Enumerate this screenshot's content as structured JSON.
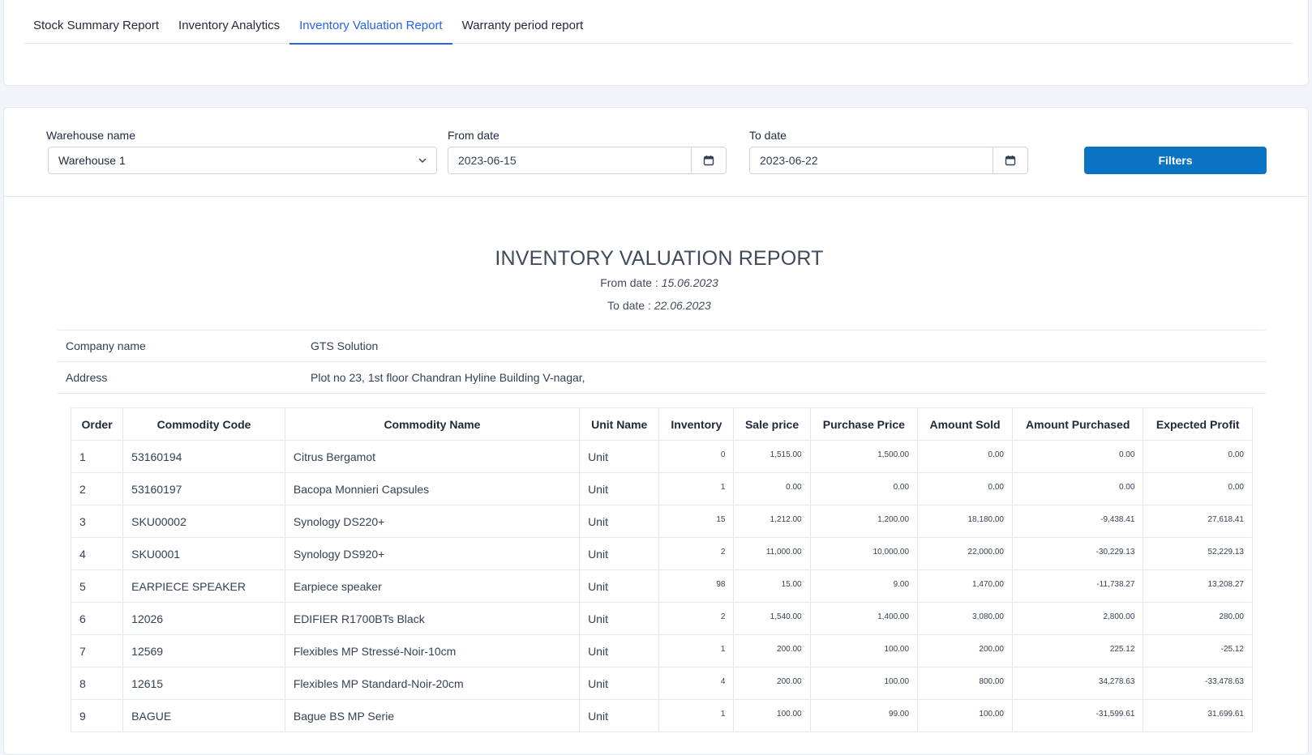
{
  "tabs": [
    {
      "label": "Stock Summary Report",
      "active": false
    },
    {
      "label": "Inventory Analytics",
      "active": false
    },
    {
      "label": "Inventory Valuation Report",
      "active": true
    },
    {
      "label": "Warranty period report",
      "active": false
    }
  ],
  "filters": {
    "warehouse_label": "Warehouse name",
    "warehouse_value": "Warehouse 1",
    "from_label": "From date",
    "from_value": "2023-06-15",
    "to_label": "To date",
    "to_value": "2023-06-22",
    "button_label": "Filters"
  },
  "report": {
    "title": "INVENTORY VALUATION REPORT",
    "from_prefix": "From date :",
    "from_date": "15.06.2023",
    "to_prefix": "To date :",
    "to_date": "22.06.2023",
    "company_key": "Company name",
    "company_value": "GTS Solution",
    "address_key": "Address",
    "address_value": "Plot no 23, 1st floor Chandran Hyline Building V-nagar,"
  },
  "table": {
    "headers": [
      "Order",
      "Commodity Code",
      "Commodity Name",
      "Unit Name",
      "Inventory",
      "Sale price",
      "Purchase Price",
      "Amount Sold",
      "Amount Purchased",
      "Expected Profit"
    ],
    "rows": [
      [
        "1",
        "53160194",
        "Citrus Bergamot",
        "Unit",
        "0",
        "1,515.00",
        "1,500.00",
        "0.00",
        "0.00",
        "0.00"
      ],
      [
        "2",
        "53160197",
        "Bacopa Monnieri Capsules",
        "Unit",
        "1",
        "0.00",
        "0.00",
        "0.00",
        "0.00",
        "0.00"
      ],
      [
        "3",
        "SKU00002",
        "Synology DS220+",
        "Unit",
        "15",
        "1,212.00",
        "1,200.00",
        "18,180.00",
        "-9,438.41",
        "27,618.41"
      ],
      [
        "4",
        "SKU0001",
        "Synology DS920+",
        "Unit",
        "2",
        "11,000.00",
        "10,000.00",
        "22,000.00",
        "-30,229.13",
        "52,229.13"
      ],
      [
        "5",
        "EARPIECE SPEAKER",
        "Earpiece speaker",
        "Unit",
        "98",
        "15.00",
        "9.00",
        "1,470.00",
        "-11,738.27",
        "13,208.27"
      ],
      [
        "6",
        "12026",
        "EDIFIER R1700BTs Black",
        "Unit",
        "2",
        "1,540.00",
        "1,400.00",
        "3,080.00",
        "2,800.00",
        "280.00"
      ],
      [
        "7",
        "12569",
        "Flexibles MP Stressé-Noir-10cm",
        "Unit",
        "1",
        "200.00",
        "100.00",
        "200.00",
        "225.12",
        "-25.12"
      ],
      [
        "8",
        "12615",
        "Flexibles MP Standard-Noir-20cm",
        "Unit",
        "4",
        "200.00",
        "100.00",
        "800.00",
        "34,278.63",
        "-33,478.63"
      ],
      [
        "9",
        "BAGUE",
        "Bague BS MP Serie",
        "Unit",
        "1",
        "100.00",
        "99.00",
        "100.00",
        "-31,599.61",
        "31,699.61"
      ]
    ]
  }
}
